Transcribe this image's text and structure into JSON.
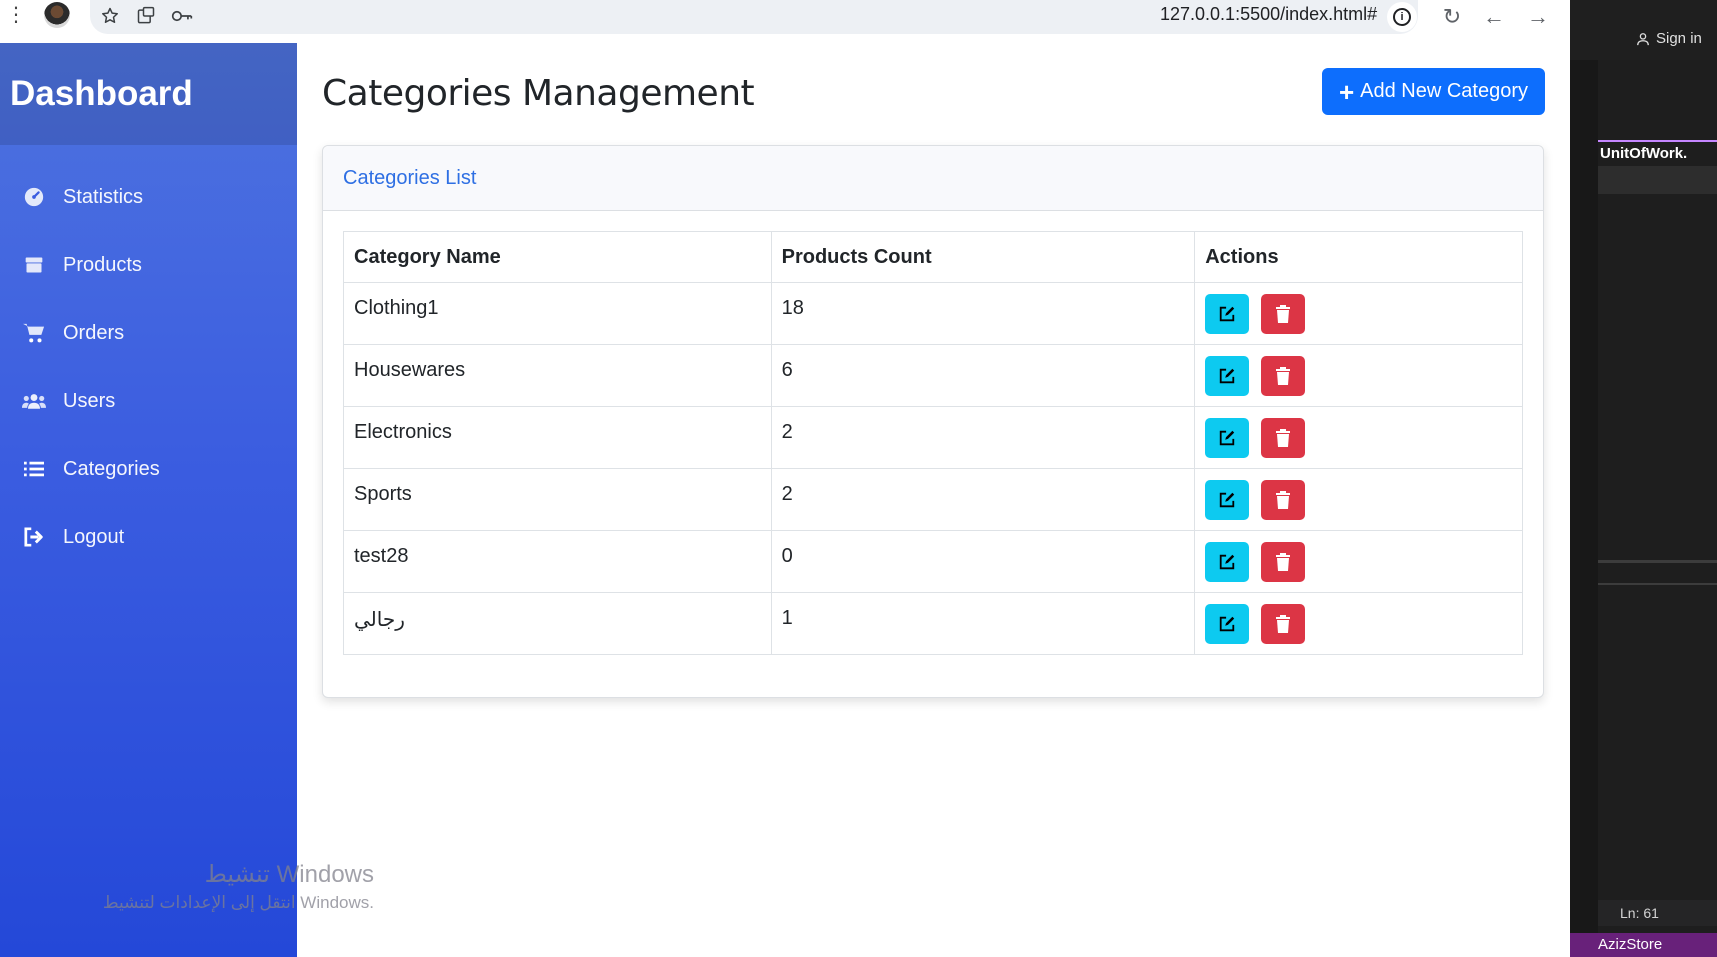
{
  "browser": {
    "url": "127.0.0.1:5500/index.html#",
    "icons": [
      "menu-dots-icon",
      "profile-avatar",
      "star-icon",
      "extension-icon",
      "key-icon",
      "info-icon",
      "reload-icon",
      "back-icon",
      "forward-icon"
    ]
  },
  "sidebar": {
    "brand": "Dashboard",
    "items": [
      {
        "label": "Statistics",
        "icon": "tachometer-icon"
      },
      {
        "label": "Products",
        "icon": "box-icon"
      },
      {
        "label": "Orders",
        "icon": "cart-icon"
      },
      {
        "label": "Users",
        "icon": "users-icon"
      },
      {
        "label": "Categories",
        "icon": "list-icon"
      },
      {
        "label": "Logout",
        "icon": "logout-icon"
      }
    ]
  },
  "main": {
    "title": "Categories Management",
    "add_button": "Add New Category",
    "card_title": "Categories List",
    "table": {
      "headers": [
        "Category Name",
        "Products Count",
        "Actions"
      ],
      "rows": [
        {
          "name": "Clothing1",
          "count": "18"
        },
        {
          "name": "Housewares",
          "count": "6"
        },
        {
          "name": "Electronics",
          "count": "2"
        },
        {
          "name": "Sports",
          "count": "2"
        },
        {
          "name": "test28",
          "count": "0"
        },
        {
          "name": "رجالي",
          "count": "1"
        }
      ]
    }
  },
  "ide": {
    "signin": "Sign in",
    "tab": "UnitOfWork.",
    "status_line": "Ln: 61",
    "project": "AzizStore"
  },
  "watermark": {
    "line1": "تنشيط Windows",
    "line2": "انتقل إلى الإعدادات لتنشيط Windows."
  },
  "colors": {
    "primary": "#0d6efd",
    "sidebar_top": "#4e73df",
    "sidebar_bottom": "#2448d8",
    "edit": "#0dcaf0",
    "delete": "#dc3545"
  }
}
